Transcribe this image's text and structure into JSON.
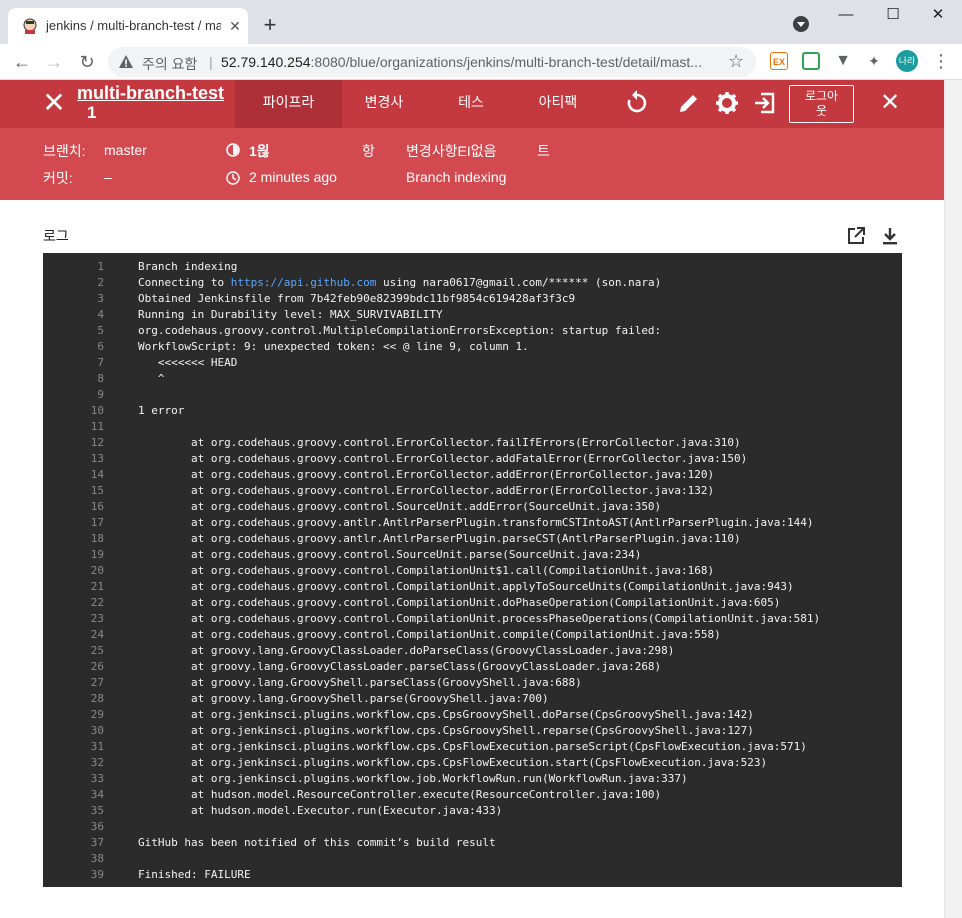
{
  "browser": {
    "tab_title": "jenkins / multi-branch-test / ma",
    "url_insecure_label": "주의 요함",
    "url_host": "52.79.140.254",
    "url_rest": ":8080/blue/organizations/jenkins/multi-branch-test/detail/mast...",
    "avatar_text": "나라",
    "ext1": "EX"
  },
  "header": {
    "job_name": "multi-branch-test",
    "run_number": "1",
    "tabs": [
      {
        "label": "파이프라",
        "active": true
      },
      {
        "label": "변경사",
        "active": false
      },
      {
        "label": "테스",
        "active": false
      },
      {
        "label": "아티팩",
        "active": false
      }
    ],
    "logout_label": "로그아\n웃"
  },
  "summary": {
    "branch_label": "브랜치:",
    "branch_value": "master",
    "commit_label": "커밋:",
    "commit_value": "–",
    "duration": "1읞",
    "time_ago": "2 minutes ago",
    "changes_prefix": "항",
    "changes_value": "변경사항EI없음",
    "changes_suffix": "트",
    "cause": "Branch indexing"
  },
  "log": {
    "title": "로그",
    "lines": [
      {
        "n": "1",
        "t": "Branch indexing"
      },
      {
        "n": "2",
        "t": "Connecting to ",
        "link": "https://api.github.com",
        "after": " using nara0617@gmail.com/****** (son.nara)"
      },
      {
        "n": "3",
        "t": "Obtained Jenkinsfile from 7b42feb90e82399bdc11bf9854c619428af3f3c9"
      },
      {
        "n": "4",
        "t": "Running in Durability level: MAX_SURVIVABILITY"
      },
      {
        "n": "5",
        "t": "org.codehaus.groovy.control.MultipleCompilationErrorsException: startup failed:"
      },
      {
        "n": "6",
        "t": "WorkflowScript: 9: unexpected token: << @ line 9, column 1."
      },
      {
        "n": "7",
        "t": "   <<<<<<< HEAD"
      },
      {
        "n": "8",
        "t": "   ^"
      },
      {
        "n": "9",
        "t": ""
      },
      {
        "n": "10",
        "t": "1 error"
      },
      {
        "n": "11",
        "t": ""
      },
      {
        "n": "12",
        "t": "        at org.codehaus.groovy.control.ErrorCollector.failIfErrors(ErrorCollector.java:310)"
      },
      {
        "n": "13",
        "t": "        at org.codehaus.groovy.control.ErrorCollector.addFatalError(ErrorCollector.java:150)"
      },
      {
        "n": "14",
        "t": "        at org.codehaus.groovy.control.ErrorCollector.addError(ErrorCollector.java:120)"
      },
      {
        "n": "15",
        "t": "        at org.codehaus.groovy.control.ErrorCollector.addError(ErrorCollector.java:132)"
      },
      {
        "n": "16",
        "t": "        at org.codehaus.groovy.control.SourceUnit.addError(SourceUnit.java:350)"
      },
      {
        "n": "17",
        "t": "        at org.codehaus.groovy.antlr.AntlrParserPlugin.transformCSTIntoAST(AntlrParserPlugin.java:144)"
      },
      {
        "n": "18",
        "t": "        at org.codehaus.groovy.antlr.AntlrParserPlugin.parseCST(AntlrParserPlugin.java:110)"
      },
      {
        "n": "19",
        "t": "        at org.codehaus.groovy.control.SourceUnit.parse(SourceUnit.java:234)"
      },
      {
        "n": "20",
        "t": "        at org.codehaus.groovy.control.CompilationUnit$1.call(CompilationUnit.java:168)"
      },
      {
        "n": "21",
        "t": "        at org.codehaus.groovy.control.CompilationUnit.applyToSourceUnits(CompilationUnit.java:943)"
      },
      {
        "n": "22",
        "t": "        at org.codehaus.groovy.control.CompilationUnit.doPhaseOperation(CompilationUnit.java:605)"
      },
      {
        "n": "23",
        "t": "        at org.codehaus.groovy.control.CompilationUnit.processPhaseOperations(CompilationUnit.java:581)"
      },
      {
        "n": "24",
        "t": "        at org.codehaus.groovy.control.CompilationUnit.compile(CompilationUnit.java:558)"
      },
      {
        "n": "25",
        "t": "        at groovy.lang.GroovyClassLoader.doParseClass(GroovyClassLoader.java:298)"
      },
      {
        "n": "26",
        "t": "        at groovy.lang.GroovyClassLoader.parseClass(GroovyClassLoader.java:268)"
      },
      {
        "n": "27",
        "t": "        at groovy.lang.GroovyShell.parseClass(GroovyShell.java:688)"
      },
      {
        "n": "28",
        "t": "        at groovy.lang.GroovyShell.parse(GroovyShell.java:700)"
      },
      {
        "n": "29",
        "t": "        at org.jenkinsci.plugins.workflow.cps.CpsGroovyShell.doParse(CpsGroovyShell.java:142)"
      },
      {
        "n": "30",
        "t": "        at org.jenkinsci.plugins.workflow.cps.CpsGroovyShell.reparse(CpsGroovyShell.java:127)"
      },
      {
        "n": "31",
        "t": "        at org.jenkinsci.plugins.workflow.cps.CpsFlowExecution.parseScript(CpsFlowExecution.java:571)"
      },
      {
        "n": "32",
        "t": "        at org.jenkinsci.plugins.workflow.cps.CpsFlowExecution.start(CpsFlowExecution.java:523)"
      },
      {
        "n": "33",
        "t": "        at org.jenkinsci.plugins.workflow.job.WorkflowRun.run(WorkflowRun.java:337)"
      },
      {
        "n": "34",
        "t": "        at hudson.model.ResourceController.execute(ResourceController.java:100)"
      },
      {
        "n": "35",
        "t": "        at hudson.model.Executor.run(Executor.java:433)"
      },
      {
        "n": "36",
        "t": ""
      },
      {
        "n": "37",
        "t": "GitHub has been notified of this commit’s build result"
      },
      {
        "n": "38",
        "t": ""
      },
      {
        "n": "39",
        "t": "Finished: FAILURE"
      }
    ]
  }
}
